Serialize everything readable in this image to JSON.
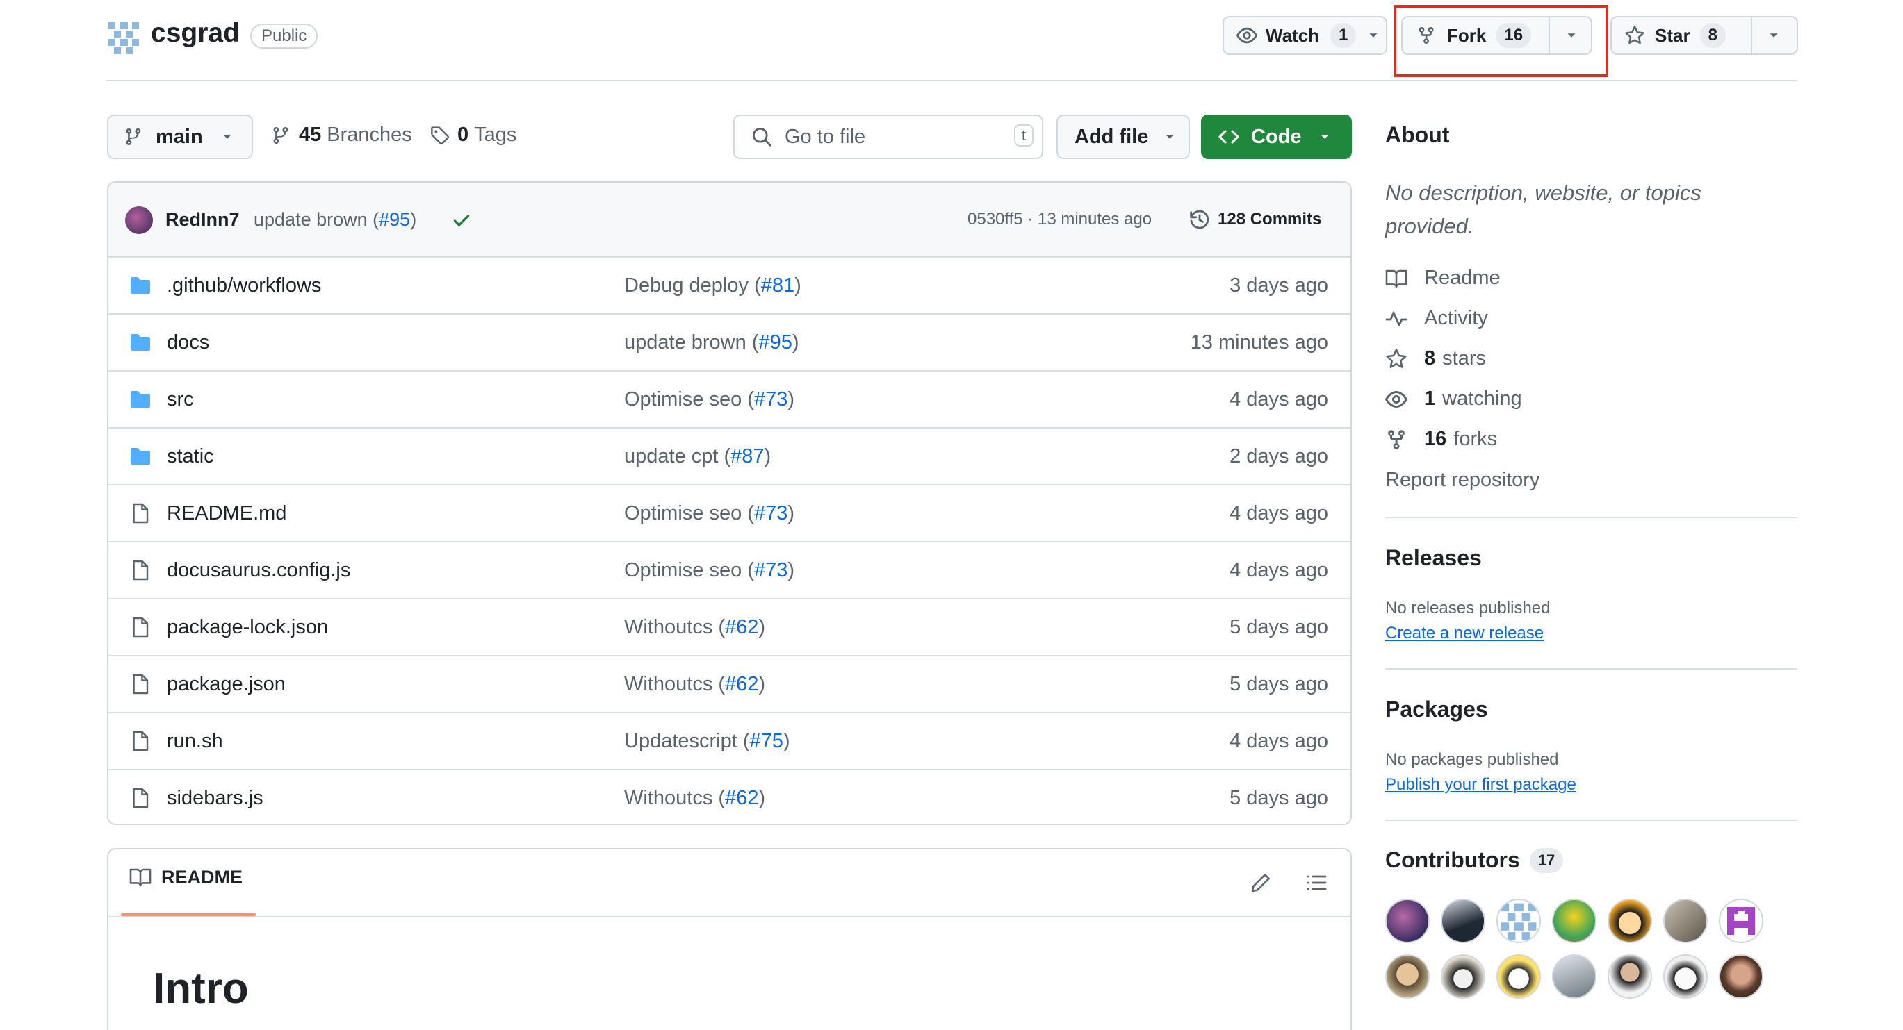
{
  "repo": {
    "name": "csgrad",
    "visibility": "Public"
  },
  "actions": {
    "watch": {
      "label": "Watch",
      "count": "1"
    },
    "fork": {
      "label": "Fork",
      "count": "16"
    },
    "star": {
      "label": "Star",
      "count": "8"
    }
  },
  "toolbar": {
    "branch": "main",
    "branches_count": "45",
    "branches_label": "Branches",
    "tags_count": "0",
    "tags_label": "Tags",
    "search_placeholder": "Go to file",
    "search_shortcut": "t",
    "add_file": "Add file",
    "code": "Code"
  },
  "latest_commit": {
    "author": "RedInn7",
    "message": "update brown (",
    "pr": "#95",
    "message_end": ")",
    "hash": "0530ff5",
    "time": "13 minutes ago",
    "commits": "128 Commits"
  },
  "files": [
    {
      "type": "folder",
      "name": ".github/workflows",
      "msg": "Debug deploy (",
      "pr": "#81",
      "age": "3 days ago"
    },
    {
      "type": "folder",
      "name": "docs",
      "msg": "update brown (",
      "pr": "#95",
      "age": "13 minutes ago"
    },
    {
      "type": "folder",
      "name": "src",
      "msg": "Optimise seo (",
      "pr": "#73",
      "age": "4 days ago"
    },
    {
      "type": "folder",
      "name": "static",
      "msg": "update cpt (",
      "pr": "#87",
      "age": "2 days ago"
    },
    {
      "type": "file",
      "name": "README.md",
      "msg": "Optimise seo (",
      "pr": "#73",
      "age": "4 days ago"
    },
    {
      "type": "file",
      "name": "docusaurus.config.js",
      "msg": "Optimise seo (",
      "pr": "#73",
      "age": "4 days ago"
    },
    {
      "type": "file",
      "name": "package-lock.json",
      "msg": "Withoutcs (",
      "pr": "#62",
      "age": "5 days ago"
    },
    {
      "type": "file",
      "name": "package.json",
      "msg": "Withoutcs (",
      "pr": "#62",
      "age": "5 days ago"
    },
    {
      "type": "file",
      "name": "run.sh",
      "msg": "Updatescript (",
      "pr": "#75",
      "age": "4 days ago"
    },
    {
      "type": "file",
      "name": "sidebars.js",
      "msg": "Withoutcs (",
      "pr": "#62",
      "age": "5 days ago"
    }
  ],
  "readme": {
    "tab": "README",
    "heading": "Intro"
  },
  "about": {
    "title": "About",
    "description": "No description, website, or topics provided.",
    "readme": "Readme",
    "activity": "Activity",
    "stars_count": "8",
    "stars_label": "stars",
    "watching_count": "1",
    "watching_label": "watching",
    "forks_count": "16",
    "forks_label": "forks",
    "report": "Report repository"
  },
  "releases": {
    "title": "Releases",
    "empty": "No releases published",
    "link": "Create a new release"
  },
  "packages": {
    "title": "Packages",
    "empty": "No packages published",
    "link": "Publish your first package"
  },
  "contributors": {
    "title": "Contributors",
    "count": "17"
  },
  "colors": {
    "accent": "#0969da",
    "code_button": "#1f883d",
    "highlight": "#d93025",
    "folder": "#54aeff"
  }
}
